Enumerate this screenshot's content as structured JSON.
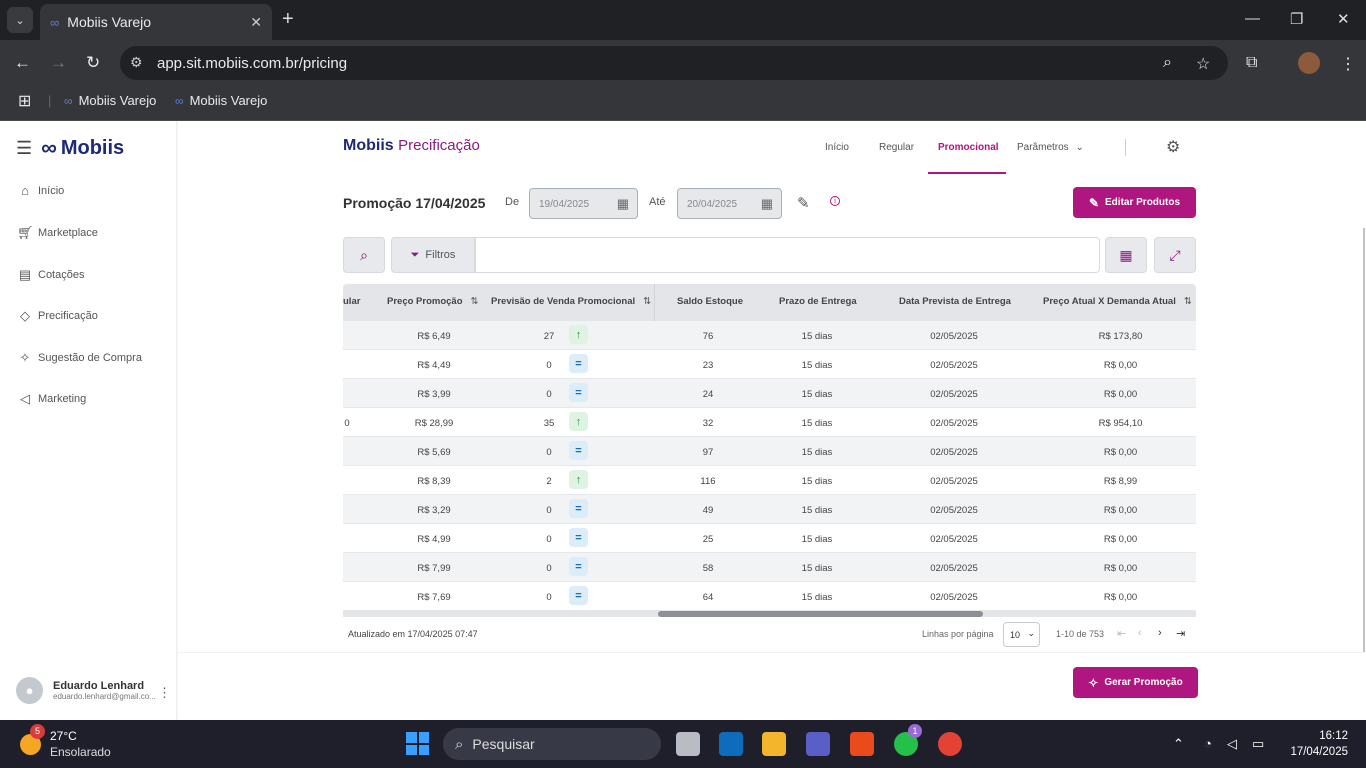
{
  "browser": {
    "tab_title": "Mobiis Varejo",
    "url": "app.sit.mobiis.com.br/pricing",
    "bookmarks": [
      "Mobiis Varejo",
      "Mobiis Varejo"
    ]
  },
  "sidebar": {
    "logo": "Mobiis",
    "items": [
      {
        "label": "Início",
        "icon": "home-icon"
      },
      {
        "label": "Marketplace",
        "icon": "cart-icon"
      },
      {
        "label": "Cotações",
        "icon": "document-icon"
      },
      {
        "label": "Precificação",
        "icon": "tag-icon"
      },
      {
        "label": "Sugestão de Compra",
        "icon": "sparkle-icon"
      },
      {
        "label": "Marketing",
        "icon": "megaphone-icon"
      }
    ],
    "user": {
      "name": "Eduardo Lenhard",
      "email": "eduardo.lenhard@gmail.co..."
    }
  },
  "header": {
    "brand": "Mobiis",
    "brand_suffix": "Precificação",
    "menu": [
      "Início",
      "Regular",
      "Promocional",
      "Parâmetros"
    ],
    "active_menu": "Promocional"
  },
  "promo": {
    "title": "Promoção 17/04/2025",
    "from_label": "De",
    "from_date": "19/04/2025",
    "to_label": "Até",
    "to_date": "20/04/2025",
    "edit_products": "Editar Produtos",
    "filters_label": "Filtros",
    "generate": "Gerar Promoção"
  },
  "table": {
    "partial_col": "ular",
    "columns": [
      "Preço Promoção",
      "Previsão de Venda Promocional",
      "Saldo Estoque",
      "Prazo de Entrega",
      "Data Prevista de Entrega",
      "Preço Atual X Demanda Atual"
    ],
    "rows": [
      {
        "partial": "",
        "price": "R$ 6,49",
        "forecast": "27",
        "trend": "up",
        "stock": "76",
        "lead": "15 dias",
        "date": "02/05/2025",
        "demand": "R$ 173,80"
      },
      {
        "partial": "",
        "price": "R$ 4,49",
        "forecast": "0",
        "trend": "eq",
        "stock": "23",
        "lead": "15 dias",
        "date": "02/05/2025",
        "demand": "R$ 0,00"
      },
      {
        "partial": "",
        "price": "R$ 3,99",
        "forecast": "0",
        "trend": "eq",
        "stock": "24",
        "lead": "15 dias",
        "date": "02/05/2025",
        "demand": "R$ 0,00"
      },
      {
        "partial": "0",
        "price": "R$ 28,99",
        "forecast": "35",
        "trend": "up",
        "stock": "32",
        "lead": "15 dias",
        "date": "02/05/2025",
        "demand": "R$ 954,10"
      },
      {
        "partial": "",
        "price": "R$ 5,69",
        "forecast": "0",
        "trend": "eq",
        "stock": "97",
        "lead": "15 dias",
        "date": "02/05/2025",
        "demand": "R$ 0,00"
      },
      {
        "partial": "",
        "price": "R$ 8,39",
        "forecast": "2",
        "trend": "up",
        "stock": "116",
        "lead": "15 dias",
        "date": "02/05/2025",
        "demand": "R$ 8,99"
      },
      {
        "partial": "",
        "price": "R$ 3,29",
        "forecast": "0",
        "trend": "eq",
        "stock": "49",
        "lead": "15 dias",
        "date": "02/05/2025",
        "demand": "R$ 0,00"
      },
      {
        "partial": "",
        "price": "R$ 4,99",
        "forecast": "0",
        "trend": "eq",
        "stock": "25",
        "lead": "15 dias",
        "date": "02/05/2025",
        "demand": "R$ 0,00"
      },
      {
        "partial": "",
        "price": "R$ 7,99",
        "forecast": "0",
        "trend": "eq",
        "stock": "58",
        "lead": "15 dias",
        "date": "02/05/2025",
        "demand": "R$ 0,00"
      },
      {
        "partial": "",
        "price": "R$ 7,69",
        "forecast": "0",
        "trend": "eq",
        "stock": "64",
        "lead": "15 dias",
        "date": "02/05/2025",
        "demand": "R$ 0,00"
      }
    ],
    "updated": "Atualizado em 17/04/2025 07:47",
    "rows_per_page_label": "Linhas por página",
    "rows_per_page": "10",
    "range": "1-10 de 753"
  },
  "taskbar": {
    "temp": "27°C",
    "weather": "Ensolarado",
    "weather_badge": "5",
    "search": "Pesquisar",
    "whatsapp_badge": "1",
    "time": "16:12",
    "date": "17/04/2025"
  },
  "colors": {
    "accent": "#b0167f",
    "brand": "#1e2a78"
  }
}
